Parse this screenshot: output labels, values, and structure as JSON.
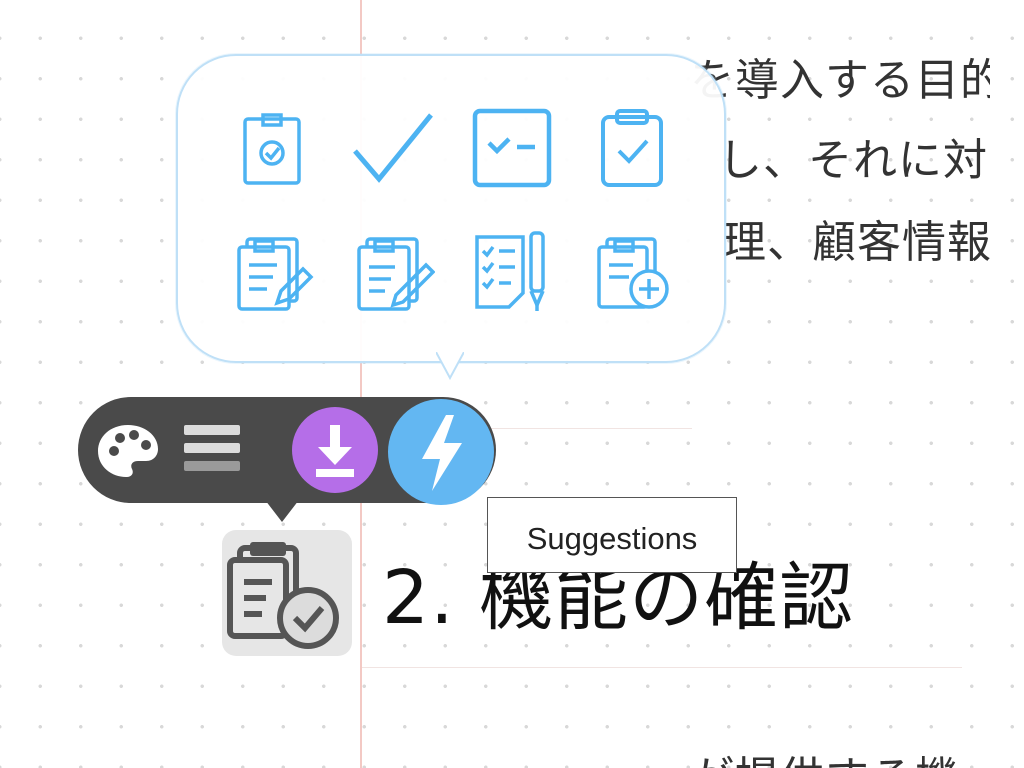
{
  "document": {
    "lines": [
      "を導入する目的",
      "し、それに対",
      "理、顧客情報",
      "が提供する機"
    ],
    "heading": "2. 機能の確認"
  },
  "popover": {
    "icons": [
      "clipboard-check-icon",
      "checkmark-icon",
      "checkbox-list-icon",
      "clipboard-tick-icon",
      "clipboard-edit-icon",
      "clipboard-pencil-icon",
      "checklist-pen-icon",
      "clipboard-add-icon"
    ]
  },
  "toolbar": {
    "buttons": [
      "palette-icon",
      "lines-icon",
      "download-icon",
      "bolt-icon"
    ],
    "colors": {
      "bar": "#4a4a4a",
      "download": "#b56ee8",
      "bolt": "#63b7f2"
    }
  },
  "tooltip": {
    "text": "Suggestions"
  },
  "colors": {
    "icon_blue": "#4db3f2",
    "margin_line": "#f3c9c4"
  }
}
